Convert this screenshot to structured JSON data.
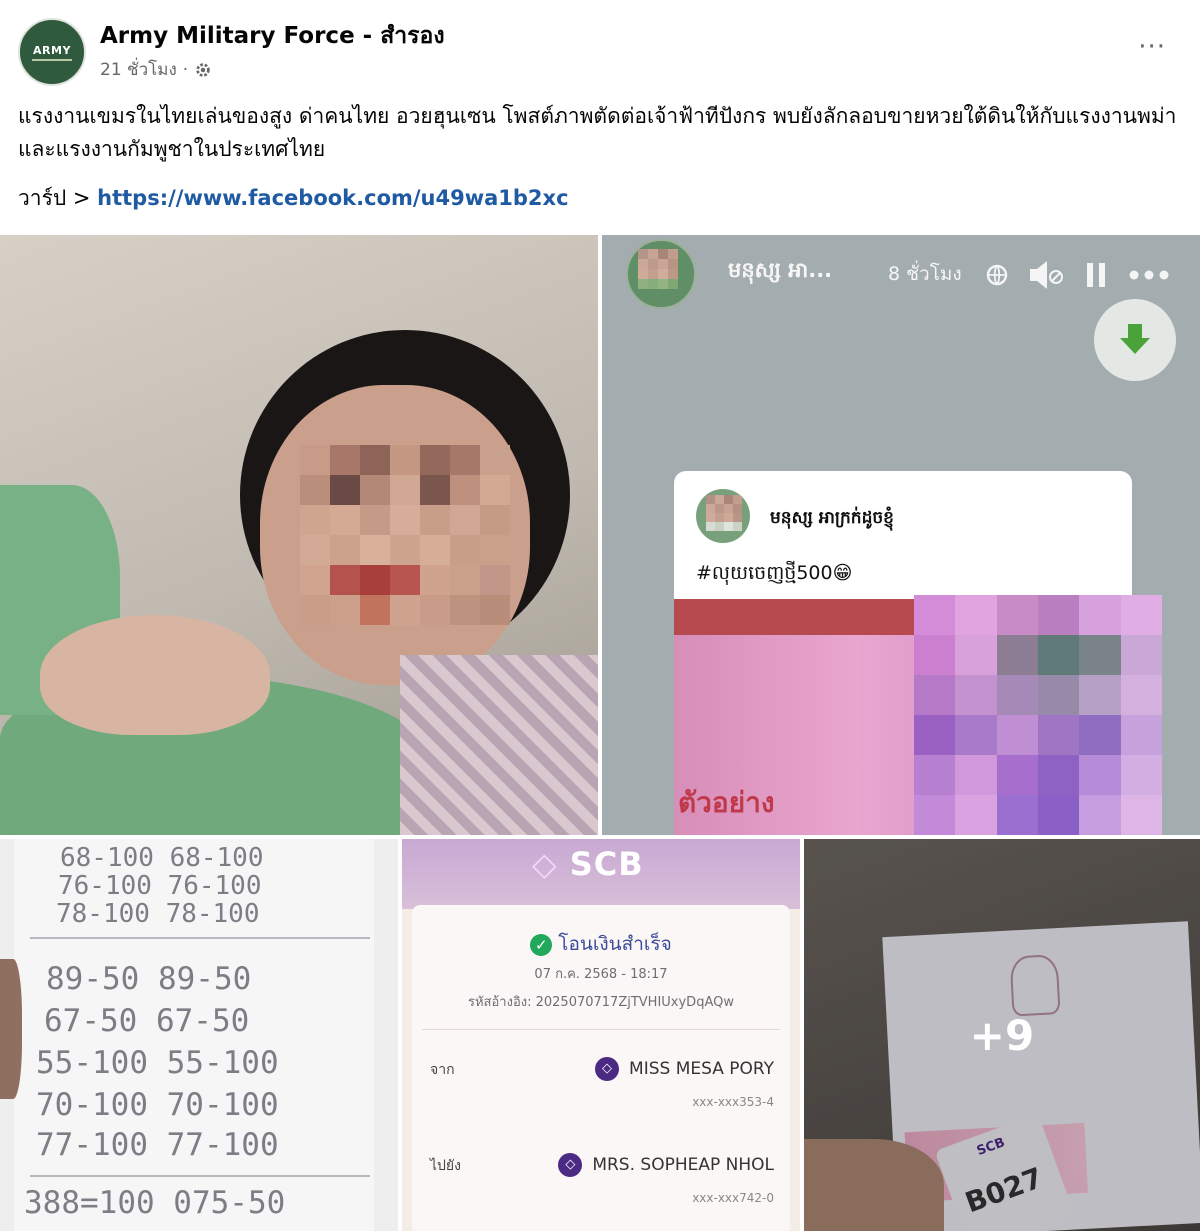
{
  "post": {
    "page_name": "Army Military Force - สำรอง",
    "avatar_text": "ARMY",
    "time": "21 ชั่วโมง",
    "separator": "·",
    "more_label": "···",
    "text": "แรงงานเขมรในไทยเล่นของสูง ด่าคนไทย อวยฮุนเซน โพสต์ภาพตัดต่อเจ้าฟ้าทีปังกร พบยังลักลอบขายหวยใต้ดินให้กับแรงงานพม่า และแรงงานกัมพูชาในประเทศไทย",
    "warp_label": "วาร์ป >",
    "warp_link": "https://www.facebook.com/u49wa1b2xc"
  },
  "story": {
    "name": "មនុស្ស អា...",
    "time": "8 ชั่วโมง",
    "card_name": "មនុស្ស អាក្រក់ដូចខ្ញុំ",
    "card_tag": "#លុយចេញថ្មី500😁",
    "sample_text": "ตัวอย่าง"
  },
  "note": {
    "lines": [
      "68-100  68-100",
      "76-100  76-100",
      "78-100  78-100",
      "89-50  89-50",
      "67-50  67-50",
      "55-100 55-100",
      "70-100 70-100",
      "77-100 77-100",
      "388=100  075-50"
    ]
  },
  "scb": {
    "logo": "SCB",
    "status": "โอนเงินสำเร็จ",
    "date": "07 ก.ค. 2568 - 18:17",
    "ref": "รหัสอ้างอิง: 2025070717ZjTVHIUxyDqAQw",
    "from_label": "จาก",
    "from_name": "MISS MESA PORY",
    "from_acc": "xxx-xxx353-4",
    "to_label": "ไปยัง",
    "to_name": "MRS. SOPHEAP NHOL",
    "to_acc": "xxx-xxx742-0"
  },
  "card5": {
    "more_count": "+9",
    "tag_text": "B027",
    "tag_brand": "SCB"
  },
  "colors": {
    "link": "#1f5aa3",
    "meta": "#65676b",
    "scb_purple": "#4b2a83",
    "ok_green": "#22a85a"
  }
}
